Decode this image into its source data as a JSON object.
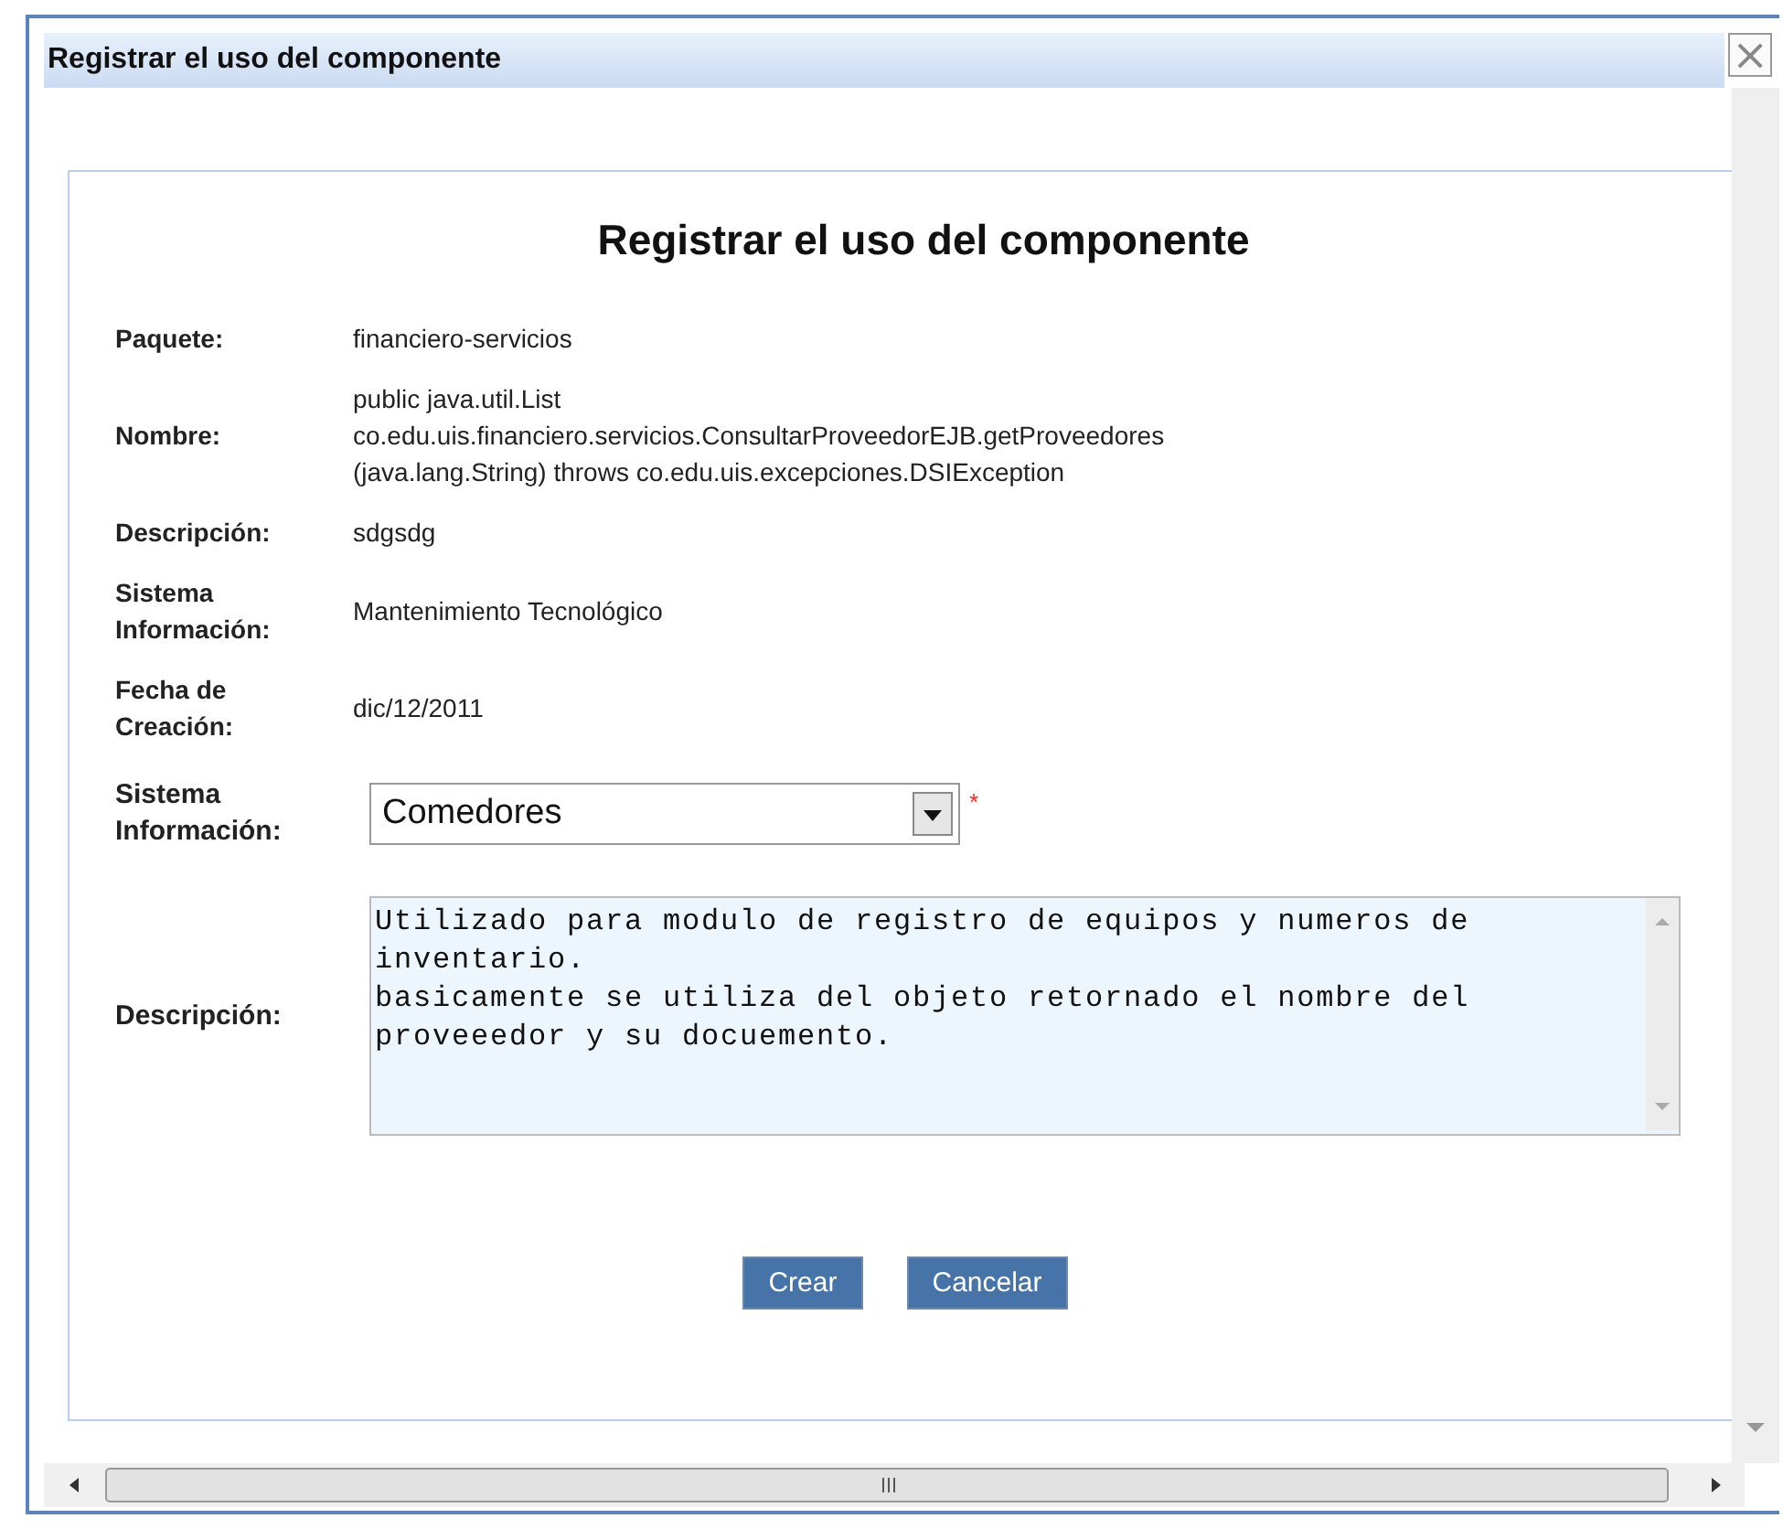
{
  "window": {
    "title": "Registrar el uso del componente",
    "close": "×"
  },
  "form": {
    "heading": "Registrar el uso del componente",
    "info_rows": [
      {
        "label": "Paquete:",
        "lines": [
          "financiero-servicios"
        ]
      },
      {
        "label": "Nombre:",
        "lines": [
          "public java.util.List",
          "co.edu.uis.financiero.servicios.ConsultarProveedorEJB.getProveedores",
          "(java.lang.String) throws co.edu.uis.excepciones.DSIException"
        ]
      },
      {
        "label": "Descripción:",
        "lines": [
          "sdgsdg"
        ]
      },
      {
        "label": "Sistema Información:",
        "lines": [
          "Mantenimiento Tecnológico"
        ]
      },
      {
        "label": "Fecha de Creación:",
        "lines": [
          "dic/12/2011"
        ]
      }
    ],
    "system": {
      "label": "Sistema Información:",
      "value": "Comedores",
      "required_mark": "*"
    },
    "description": {
      "label": "Descripción:",
      "value": "Utilizado para modulo de registro de equipos y numeros de inventario.\nbasicamente se utiliza del objeto retornado el nombre del proveeedor y su docuemento."
    },
    "buttons": [
      "Crear",
      "Cancelar"
    ]
  }
}
